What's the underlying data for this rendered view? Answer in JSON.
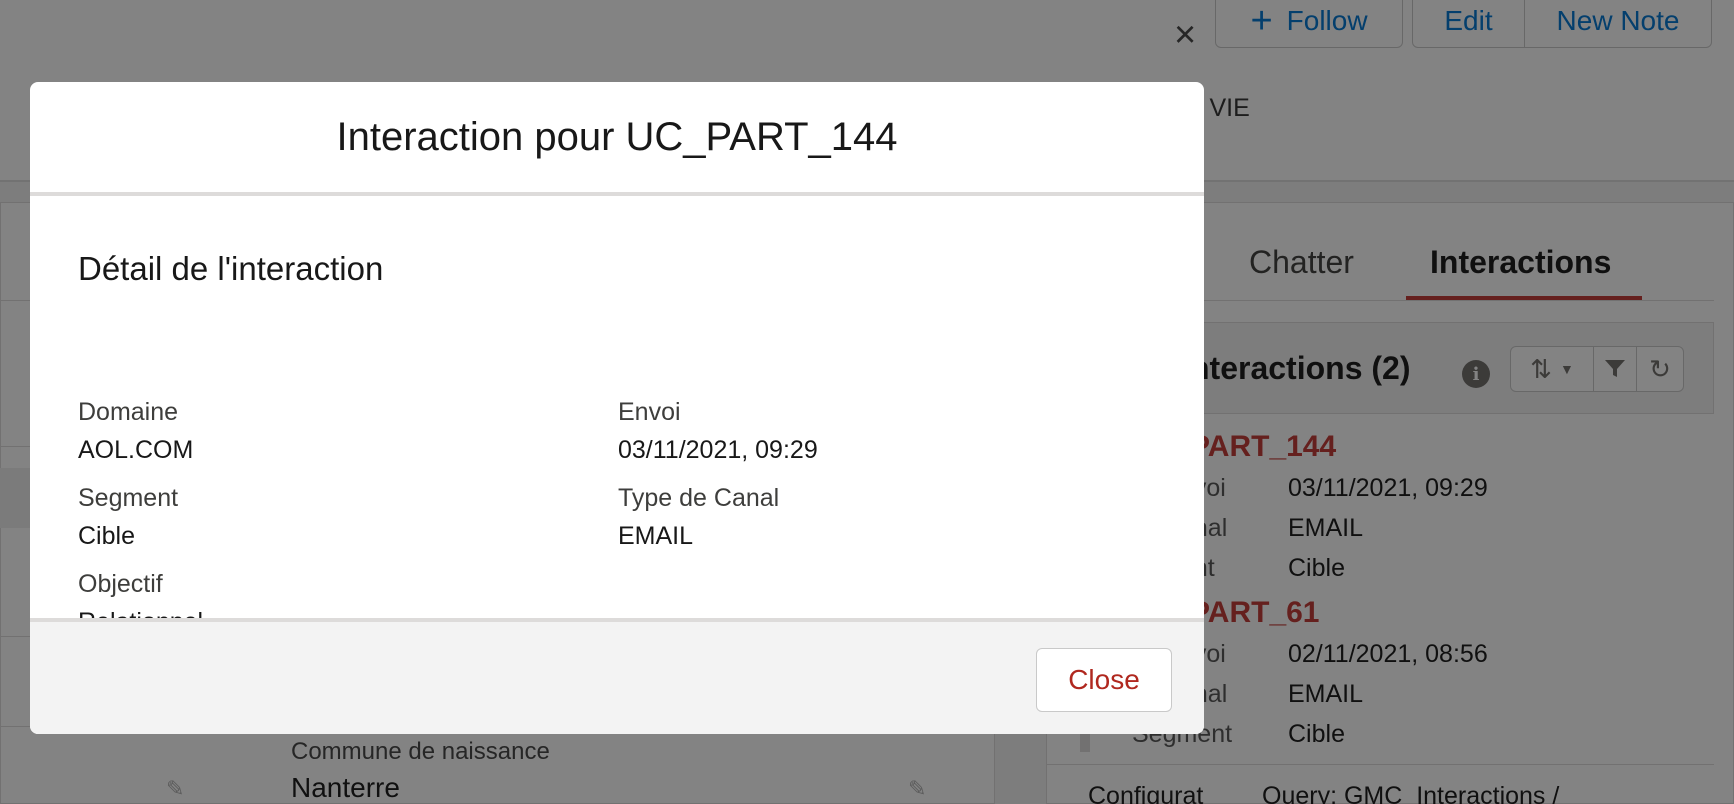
{
  "background": {
    "header": {
      "close_glyph": "×",
      "follow_label": "Follow",
      "edit_label": "Edit",
      "new_note_label": "New Note",
      "partial_text": "s VIE"
    },
    "left_panel": {
      "commune_label": "Commune de naissance",
      "commune_value": "Nanterre"
    },
    "right_panel": {
      "tabs": [
        {
          "label": "Chatter"
        },
        {
          "label": "Interactions"
        }
      ],
      "related_title": "nteractions (2)",
      "records": [
        {
          "name": "PART_144",
          "rows": [
            {
              "label": "nvoi",
              "value": "03/11/2021, 09:29"
            },
            {
              "label": "anal",
              "value": "EMAIL"
            },
            {
              "label": "ent",
              "value": "Cible"
            }
          ]
        },
        {
          "name": "PART_61",
          "rows": [
            {
              "label": "nvoi",
              "value": "02/11/2021, 08:56"
            },
            {
              "label": "anal",
              "value": "EMAIL"
            },
            {
              "label": "Segment",
              "value": "Cible"
            }
          ]
        }
      ],
      "footer_label": "Configurat",
      "footer_value": "Query: GMC_Interactions /"
    }
  },
  "modal": {
    "title": "Interaction pour UC_PART_144",
    "section_title": "Détail de l'interaction",
    "fields": {
      "domaine": {
        "label": "Domaine",
        "value": "AOL.COM"
      },
      "envoi": {
        "label": "Envoi",
        "value": "03/11/2021, 09:29"
      },
      "segment": {
        "label": "Segment",
        "value": "Cible"
      },
      "type_canal": {
        "label": "Type de Canal",
        "value": "EMAIL"
      },
      "objectif": {
        "label": "Objectif",
        "value": "Relationnel"
      }
    },
    "close_label": "Close"
  },
  "colors": {
    "brand_blue": "#0176d3",
    "accent_red": "#c23934",
    "close_text": "#b0281f"
  }
}
